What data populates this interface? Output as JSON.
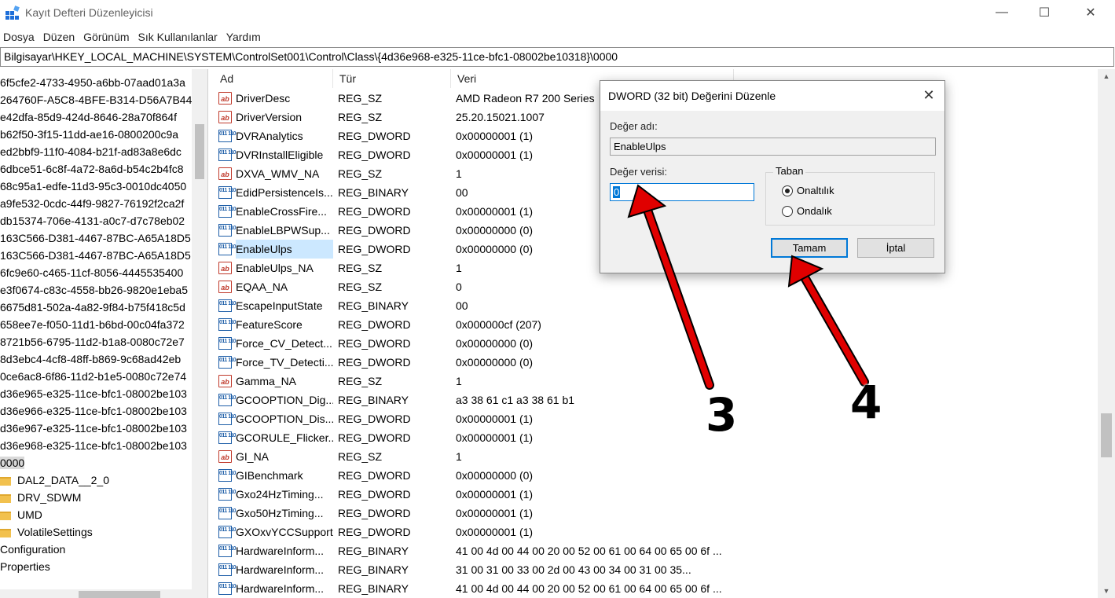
{
  "window": {
    "title": "Kayıt Defteri Düzenleyicisi",
    "min_glyph": "—",
    "max_glyph": "☐",
    "close_glyph": "✕"
  },
  "menu": [
    "Dosya",
    "Düzen",
    "Görünüm",
    "Sık Kullanılanlar",
    "Yardım"
  ],
  "address": "Bilgisayar\\HKEY_LOCAL_MACHINE\\SYSTEM\\ControlSet001\\Control\\Class\\{4d36e968-e325-11ce-bfc1-08002be10318}\\0000",
  "tree": {
    "items": [
      {
        "label": "6f5cfe2-4733-4950-a6bb-07aad01a3a",
        "kind": "key"
      },
      {
        "label": "264760F-A5C8-4BFE-B314-D56A7B44",
        "kind": "key"
      },
      {
        "label": "e42dfa-85d9-424d-8646-28a70f864f",
        "kind": "key"
      },
      {
        "label": "b62f50-3f15-11dd-ae16-0800200c9a",
        "kind": "key"
      },
      {
        "label": "ed2bbf9-11f0-4084-b21f-ad83a8e6dc",
        "kind": "key"
      },
      {
        "label": "6dbce51-6c8f-4a72-8a6d-b54c2b4fc8",
        "kind": "key"
      },
      {
        "label": "68c95a1-edfe-11d3-95c3-0010dc4050",
        "kind": "key"
      },
      {
        "label": "a9fe532-0cdc-44f9-9827-76192f2ca2f",
        "kind": "key"
      },
      {
        "label": "db15374-706e-4131-a0c7-d7c78eb02",
        "kind": "key"
      },
      {
        "label": "163C566-D381-4467-87BC-A65A18D5",
        "kind": "key"
      },
      {
        "label": "163C566-D381-4467-87BC-A65A18D5",
        "kind": "key"
      },
      {
        "label": "6fc9e60-c465-11cf-8056-4445535400",
        "kind": "key"
      },
      {
        "label": "e3f0674-c83c-4558-bb26-9820e1eba5",
        "kind": "key"
      },
      {
        "label": "6675d81-502a-4a82-9f84-b75f418c5d",
        "kind": "key"
      },
      {
        "label": "658ee7e-f050-11d1-b6bd-00c04fa372",
        "kind": "key"
      },
      {
        "label": "8721b56-6795-11d2-b1a8-0080c72e7",
        "kind": "key"
      },
      {
        "label": "8d3ebc4-4cf8-48ff-b869-9c68ad42eb",
        "kind": "key"
      },
      {
        "label": "0ce6ac8-6f86-11d2-b1e5-0080c72e74",
        "kind": "key"
      },
      {
        "label": "d36e965-e325-11ce-bfc1-08002be103",
        "kind": "key"
      },
      {
        "label": "d36e966-e325-11ce-bfc1-08002be103",
        "kind": "key"
      },
      {
        "label": "d36e967-e325-11ce-bfc1-08002be103",
        "kind": "key"
      },
      {
        "label": "d36e968-e325-11ce-bfc1-08002be103",
        "kind": "key"
      },
      {
        "label": "0000",
        "kind": "selected"
      },
      {
        "label": "DAL2_DATA__2_0",
        "kind": "folder"
      },
      {
        "label": "DRV_SDWM",
        "kind": "folder"
      },
      {
        "label": "UMD",
        "kind": "folder"
      },
      {
        "label": "VolatileSettings",
        "kind": "folder"
      },
      {
        "label": "Configuration",
        "kind": "key"
      },
      {
        "label": "Properties",
        "kind": "key"
      }
    ]
  },
  "list": {
    "columns": [
      "Ad",
      "Tür",
      "Veri"
    ],
    "rows": [
      {
        "icon": "string-value-icon",
        "name": "DriverDesc",
        "type": "REG_SZ",
        "data": "AMD Radeon R7 200 Series"
      },
      {
        "icon": "string-value-icon",
        "name": "DriverVersion",
        "type": "REG_SZ",
        "data": "25.20.15021.1007"
      },
      {
        "icon": "binary-value-icon",
        "name": "DVRAnalytics",
        "type": "REG_DWORD",
        "data": "0x00000001 (1)"
      },
      {
        "icon": "binary-value-icon",
        "name": "DVRInstallEligible",
        "type": "REG_DWORD",
        "data": "0x00000001 (1)"
      },
      {
        "icon": "string-value-icon",
        "name": "DXVA_WMV_NA",
        "type": "REG_SZ",
        "data": "1"
      },
      {
        "icon": "binary-value-icon",
        "name": "EdidPersistenceIs...",
        "type": "REG_BINARY",
        "data": "00"
      },
      {
        "icon": "binary-value-icon",
        "name": "EnableCrossFire...",
        "type": "REG_DWORD",
        "data": "0x00000001 (1)"
      },
      {
        "icon": "binary-value-icon",
        "name": "EnableLBPWSup...",
        "type": "REG_DWORD",
        "data": "0x00000000 (0)"
      },
      {
        "icon": "binary-value-icon",
        "name": "EnableUlps",
        "type": "REG_DWORD",
        "data": "0x00000000 (0)",
        "selected": true
      },
      {
        "icon": "string-value-icon",
        "name": "EnableUlps_NA",
        "type": "REG_SZ",
        "data": "1"
      },
      {
        "icon": "string-value-icon",
        "name": "EQAA_NA",
        "type": "REG_SZ",
        "data": "0"
      },
      {
        "icon": "binary-value-icon",
        "name": "EscapeInputState",
        "type": "REG_BINARY",
        "data": "00"
      },
      {
        "icon": "binary-value-icon",
        "name": "FeatureScore",
        "type": "REG_DWORD",
        "data": "0x000000cf (207)"
      },
      {
        "icon": "binary-value-icon",
        "name": "Force_CV_Detect...",
        "type": "REG_DWORD",
        "data": "0x00000000 (0)"
      },
      {
        "icon": "binary-value-icon",
        "name": "Force_TV_Detecti...",
        "type": "REG_DWORD",
        "data": "0x00000000 (0)"
      },
      {
        "icon": "string-value-icon",
        "name": "Gamma_NA",
        "type": "REG_SZ",
        "data": "1"
      },
      {
        "icon": "binary-value-icon",
        "name": "GCOOPTION_Dig...",
        "type": "REG_BINARY",
        "data": "a3 38 61 c1 a3 38 61 b1"
      },
      {
        "icon": "binary-value-icon",
        "name": "GCOOPTION_Dis...",
        "type": "REG_DWORD",
        "data": "0x00000001 (1)"
      },
      {
        "icon": "binary-value-icon",
        "name": "GCORULE_Flicker...",
        "type": "REG_DWORD",
        "data": "0x00000001 (1)"
      },
      {
        "icon": "string-value-icon",
        "name": "GI_NA",
        "type": "REG_SZ",
        "data": "1"
      },
      {
        "icon": "binary-value-icon",
        "name": "GIBenchmark",
        "type": "REG_DWORD",
        "data": "0x00000000 (0)"
      },
      {
        "icon": "binary-value-icon",
        "name": "Gxo24HzTiming...",
        "type": "REG_DWORD",
        "data": "0x00000001 (1)"
      },
      {
        "icon": "binary-value-icon",
        "name": "Gxo50HzTiming...",
        "type": "REG_DWORD",
        "data": "0x00000001 (1)"
      },
      {
        "icon": "binary-value-icon",
        "name": "GXOxvYCCSupport",
        "type": "REG_DWORD",
        "data": "0x00000001 (1)"
      },
      {
        "icon": "binary-value-icon",
        "name": "HardwareInform...",
        "type": "REG_BINARY",
        "data": "41 00 4d 00 44 00 20 00 52 00 61 00 64 00 65 00 6f ..."
      },
      {
        "icon": "binary-value-icon",
        "name": "HardwareInform...",
        "type": "REG_BINARY",
        "data": "31 00 31 00 33 00 2d 00 43 00 34 00 31 00 35..."
      },
      {
        "icon": "binary-value-icon",
        "name": "HardwareInform...",
        "type": "REG_BINARY",
        "data": "41 00 4d 00 44 00 20 00 52 00 61 00 64 00 65 00 6f ..."
      }
    ]
  },
  "dialog": {
    "title": "DWORD (32 bit) Değerini Düzenle",
    "value_name_label": "Değer adı:",
    "value_name": "EnableUlps",
    "value_data_label": "Değer verisi:",
    "value_data": "0",
    "base_label": "Taban",
    "base_options": [
      "Onaltılık",
      "Ondalık"
    ],
    "base_selected": "Onaltılık",
    "ok_label": "Tamam",
    "cancel_label": "İptal",
    "close_glyph": "✕"
  },
  "annotations": {
    "color": "#e00000",
    "labels": [
      "3",
      "4"
    ]
  }
}
